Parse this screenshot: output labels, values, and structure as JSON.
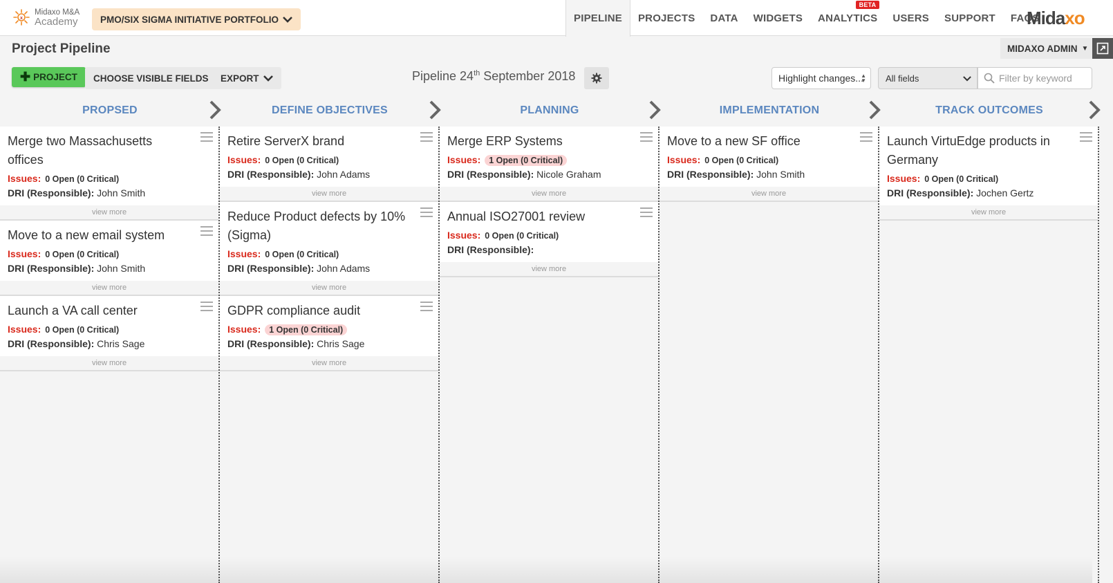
{
  "app": {
    "logo_line1": "Midaxo M&A",
    "logo_line2": "Academy",
    "portfolio": "PMO/SIX SIGMA INITIATIVE PORTFOLIO",
    "brand_a": "Mida",
    "brand_b": "xo",
    "brand_color": "#f08a24"
  },
  "nav": {
    "items": [
      "PIPELINE",
      "PROJECTS",
      "DATA",
      "WIDGETS",
      "ANALYTICS",
      "USERS",
      "SUPPORT",
      "FAQS"
    ],
    "beta_label": "BETA",
    "active": "PIPELINE"
  },
  "header": {
    "page_title": "Project Pipeline",
    "admin_label": "MIDAXO ADMIN",
    "add_project": "PROJECT",
    "choose_fields": "CHOOSE VISIBLE FIELDS",
    "export": "EXPORT",
    "pipeline_prefix": "Pipeline 24",
    "pipeline_sup": "th",
    "pipeline_suffix": " September 2018",
    "highlight_select": "Highlight changes...",
    "fields_select": "All fields",
    "filter_placeholder": "Filter by keyword"
  },
  "labels": {
    "issues": "Issues:",
    "dri": "DRI (Responsible):",
    "view_more": "view more"
  },
  "stages": [
    {
      "name": "PROPSED",
      "cards": [
        {
          "title": "Merge two Massachusetts offices",
          "issues": "0 Open  (0 Critical)",
          "issues_highlight": false,
          "dri": "John Smith"
        },
        {
          "title": "Move to a new email system",
          "issues": "0 Open  (0 Critical)",
          "issues_highlight": false,
          "dri": "John Smith"
        },
        {
          "title": "Launch a VA call center",
          "issues": "0 Open  (0 Critical)",
          "issues_highlight": false,
          "dri": "Chris Sage"
        }
      ]
    },
    {
      "name": "DEFINE OBJECTIVES",
      "cards": [
        {
          "title": "Retire ServerX brand",
          "issues": "0 Open  (0 Critical)",
          "issues_highlight": false,
          "dri": "John Adams"
        },
        {
          "title": "Reduce Product defects by 10% (Sigma)",
          "issues": "0 Open  (0 Critical)",
          "issues_highlight": false,
          "dri": "John Adams"
        },
        {
          "title": "GDPR compliance audit",
          "issues": "1 Open  (0 Critical)",
          "issues_highlight": true,
          "dri": "Chris Sage"
        }
      ]
    },
    {
      "name": "PLANNING",
      "cards": [
        {
          "title": "Merge ERP Systems",
          "issues": "1 Open  (0 Critical)",
          "issues_highlight": true,
          "dri": "Nicole Graham"
        },
        {
          "title": "Annual ISO27001 review",
          "issues": "0 Open  (0 Critical)",
          "issues_highlight": false,
          "dri": ""
        }
      ]
    },
    {
      "name": "IMPLEMENTATION",
      "cards": [
        {
          "title": "Move to a new SF office",
          "issues": "0 Open  (0 Critical)",
          "issues_highlight": false,
          "dri": "John Smith"
        }
      ]
    },
    {
      "name": "TRACK OUTCOMES",
      "cards": [
        {
          "title": "Launch VirtuEdge products in Germany",
          "issues": "0 Open  (0 Critical)",
          "issues_highlight": false,
          "dri": "Jochen Gertz"
        }
      ]
    }
  ],
  "colors": {
    "stage_heading": "#5b87bf",
    "issues_red": "#d9291c",
    "add_button": "#5ac85a",
    "portfolio_bg": "#fbe3c6",
    "issue_highlight": "#fbd4d4"
  },
  "icons": {
    "add": "plus-icon",
    "gear": "gear-icon",
    "search": "search-icon",
    "card_menu": "hamburger-menu-icon",
    "stage_arrow": "chevron-right-icon",
    "expand": "expand-window-icon"
  }
}
